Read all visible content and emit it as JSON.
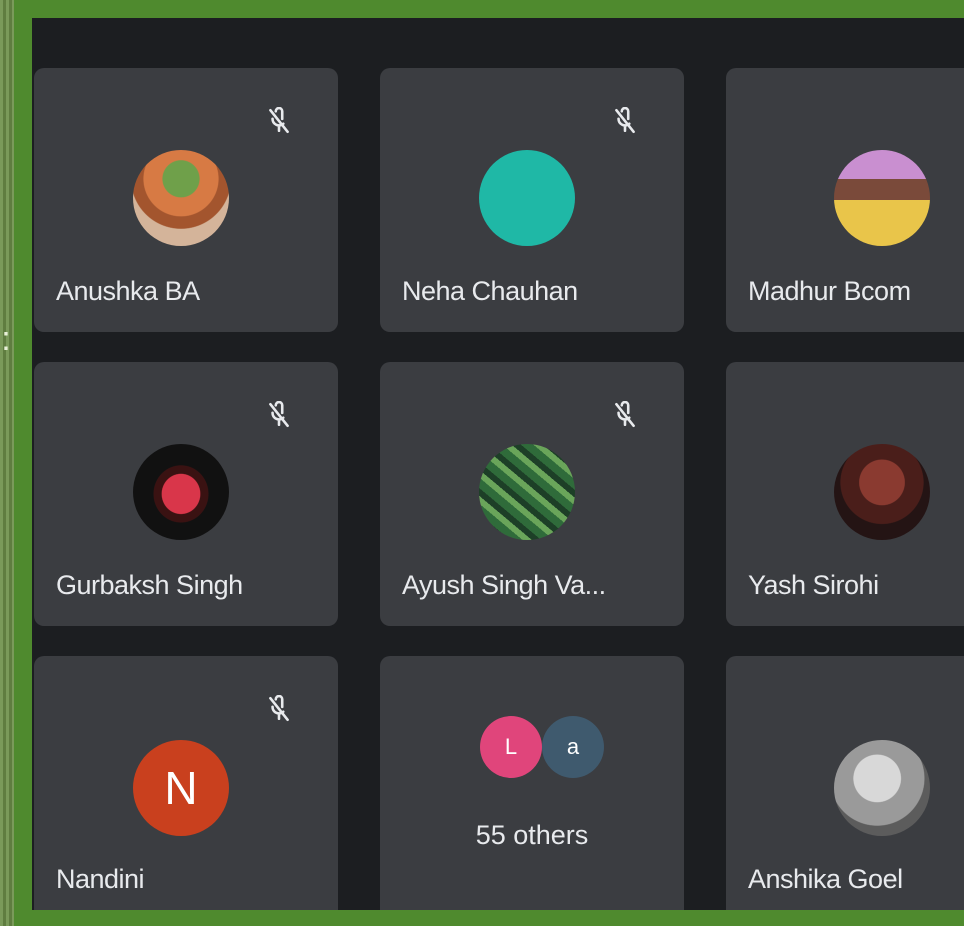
{
  "participants": [
    {
      "name": "Anushka BA",
      "muted": true
    },
    {
      "name": "Neha Chauhan",
      "muted": true
    },
    {
      "name": "Madhur Bcom",
      "muted": true
    },
    {
      "name": "Gurbaksh Singh",
      "muted": true
    },
    {
      "name": "Ayush Singh Va...",
      "muted": true
    },
    {
      "name": "Yash Sirohi",
      "muted": true
    },
    {
      "name": "Nandini",
      "muted": true,
      "initial": "N"
    },
    {
      "name": "Anshika Goel",
      "muted": true
    }
  ],
  "others": {
    "label": "55 others",
    "initials": [
      "L",
      "a"
    ]
  },
  "colors": {
    "background": "#1c1e21",
    "tile": "#3b3d41",
    "nandini_avatar": "#c9401e",
    "neha_avatar": "#1fb8a6",
    "others_pink": "#e0457b",
    "others_blue": "#3f5a6e",
    "frame": "#4f8a2e"
  },
  "icons": {
    "mic_state": "mic-off-icon"
  }
}
